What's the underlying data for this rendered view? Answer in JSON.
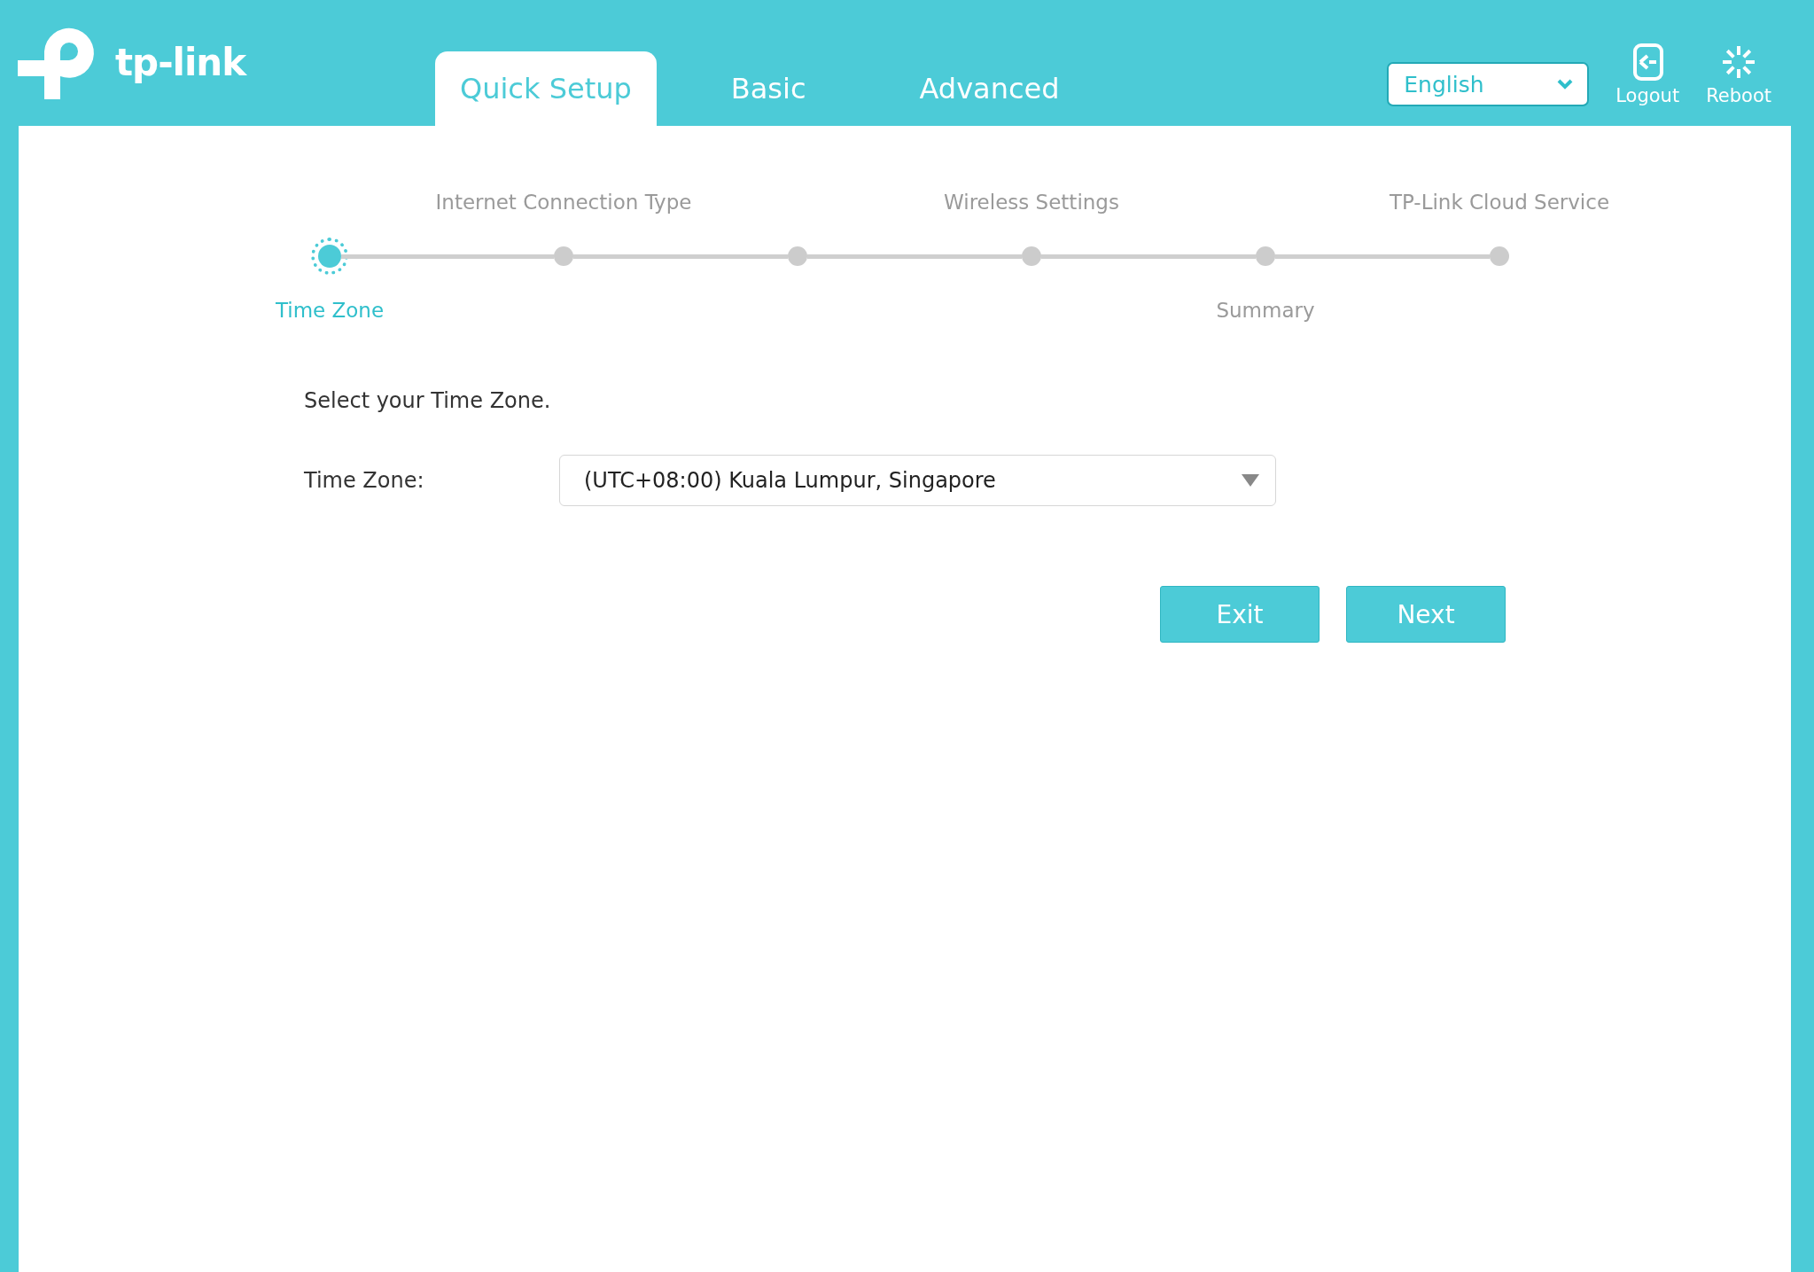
{
  "header": {
    "logo_text": "tp-link",
    "tabs": [
      {
        "label": "Quick Setup",
        "selected": true
      },
      {
        "label": "Basic",
        "selected": false
      },
      {
        "label": "Advanced",
        "selected": false
      }
    ],
    "language": {
      "value": "English"
    },
    "actions": [
      {
        "kind": "logout",
        "label": "Logout"
      },
      {
        "kind": "reboot",
        "label": "Reboot"
      }
    ]
  },
  "stepper": {
    "steps": [
      {
        "kind": "below",
        "label": "Time Zone",
        "selected": true
      },
      {
        "kind": "above",
        "label": "Internet Connection Type",
        "selected": false
      },
      {
        "selected": false
      },
      {
        "kind": "above",
        "label": "Wireless Settings",
        "selected": false
      },
      {
        "kind": "below",
        "label": "Summary",
        "selected": false
      },
      {
        "kind": "above",
        "label": "TP-Link Cloud Service",
        "selected": false
      }
    ]
  },
  "form": {
    "prompt": "Select your Time Zone.",
    "time_zone_label": "Time Zone:",
    "time_zone_value": "(UTC+08:00) Kuala Lumpur, Singapore"
  },
  "buttons": [
    "Exit",
    "Next"
  ]
}
